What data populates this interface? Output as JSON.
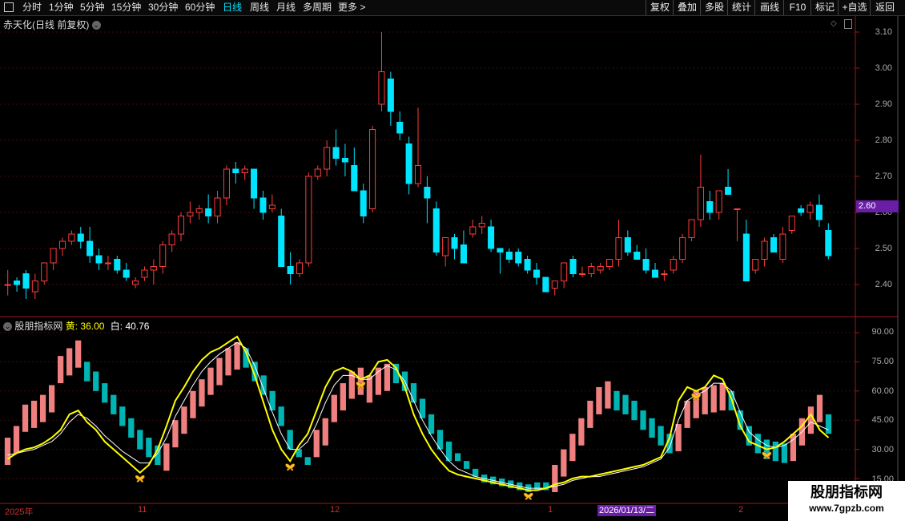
{
  "toolbar": {
    "left_items": [
      "分时",
      "1分钟",
      "5分钟",
      "15分钟",
      "30分钟",
      "60分钟",
      "日线",
      "周线",
      "月线",
      "多周期",
      "更多 >"
    ],
    "active": "日线",
    "right_items": [
      "复权",
      "叠加",
      "多股",
      "统计",
      "画线",
      "F10",
      "标记",
      "+自选",
      "返回"
    ]
  },
  "stock": {
    "title": "赤天化(日线 前复权)"
  },
  "indicator": {
    "name": "股朋指标网",
    "yellow_label": "黄:",
    "yellow_value": "36.00",
    "white_label": "白:",
    "white_value": "40.76"
  },
  "price_axis": [
    "3.10",
    "3.00",
    "2.90",
    "2.80",
    "2.70",
    "2.60",
    "2.50",
    "2.40"
  ],
  "current_price_tag": "2.60",
  "ind_axis": [
    "90.00",
    "75.00",
    "60.00",
    "45.00",
    "30.00",
    "15.00"
  ],
  "x_labels": [
    "2025年",
    "11",
    "12",
    "1",
    "2"
  ],
  "cursor_date": "2026/01/13/二",
  "watermark": {
    "title": "股朋指标网",
    "url": "www.7gpzb.com"
  },
  "colors": {
    "up": "#ff3c3c",
    "down": "#00e5ff",
    "ind_up": "#f08080",
    "ind_down": "#00b4b4",
    "yellow": "#ffff00",
    "white": "#ffffff"
  },
  "chart_data": [
    {
      "type": "candlestick",
      "title": "赤天化(日线 前复权)",
      "ylim": [
        2.36,
        3.12
      ],
      "candles": [
        [
          2.4,
          2.44,
          2.37,
          2.4
        ],
        [
          2.41,
          2.42,
          2.38,
          2.4
        ],
        [
          2.43,
          2.44,
          2.36,
          2.39
        ],
        [
          2.38,
          2.43,
          2.36,
          2.41
        ],
        [
          2.41,
          2.46,
          2.4,
          2.46
        ],
        [
          2.46,
          2.5,
          2.44,
          2.5
        ],
        [
          2.5,
          2.53,
          2.48,
          2.52
        ],
        [
          2.52,
          2.55,
          2.51,
          2.54
        ],
        [
          2.54,
          2.56,
          2.5,
          2.52
        ],
        [
          2.52,
          2.56,
          2.46,
          2.48
        ],
        [
          2.48,
          2.5,
          2.44,
          2.46
        ],
        [
          2.46,
          2.48,
          2.44,
          2.46
        ],
        [
          2.47,
          2.48,
          2.43,
          2.44
        ],
        [
          2.44,
          2.46,
          2.41,
          2.42
        ],
        [
          2.4,
          2.42,
          2.39,
          2.41
        ],
        [
          2.42,
          2.45,
          2.41,
          2.44
        ],
        [
          2.44,
          2.47,
          2.4,
          2.45
        ],
        [
          2.45,
          2.52,
          2.43,
          2.51
        ],
        [
          2.51,
          2.55,
          2.49,
          2.54
        ],
        [
          2.54,
          2.6,
          2.52,
          2.59
        ],
        [
          2.59,
          2.63,
          2.57,
          2.6
        ],
        [
          2.6,
          2.62,
          2.58,
          2.61
        ],
        [
          2.61,
          2.65,
          2.57,
          2.59
        ],
        [
          2.59,
          2.66,
          2.57,
          2.64
        ],
        [
          2.64,
          2.73,
          2.62,
          2.72
        ],
        [
          2.72,
          2.74,
          2.68,
          2.71
        ],
        [
          2.71,
          2.73,
          2.69,
          2.72
        ],
        [
          2.72,
          2.72,
          2.61,
          2.64
        ],
        [
          2.64,
          2.66,
          2.58,
          2.6
        ],
        [
          2.61,
          2.65,
          2.6,
          2.62
        ],
        [
          2.59,
          2.61,
          2.47,
          2.45
        ],
        [
          2.45,
          2.49,
          2.4,
          2.43
        ],
        [
          2.43,
          2.47,
          2.42,
          2.46
        ],
        [
          2.46,
          2.71,
          2.45,
          2.7
        ],
        [
          2.7,
          2.73,
          2.69,
          2.72
        ],
        [
          2.72,
          2.8,
          2.7,
          2.78
        ],
        [
          2.78,
          2.83,
          2.73,
          2.75
        ],
        [
          2.75,
          2.79,
          2.7,
          2.74
        ],
        [
          2.73,
          2.78,
          2.67,
          2.66
        ],
        [
          2.66,
          2.68,
          2.57,
          2.59
        ],
        [
          2.61,
          2.84,
          2.6,
          2.83
        ],
        [
          2.9,
          3.1,
          2.88,
          2.99
        ],
        [
          2.97,
          2.99,
          2.84,
          2.88
        ],
        [
          2.85,
          2.88,
          2.8,
          2.82
        ],
        [
          2.79,
          2.81,
          2.65,
          2.68
        ],
        [
          2.68,
          2.89,
          2.67,
          2.73
        ],
        [
          2.67,
          2.7,
          2.57,
          2.64
        ],
        [
          2.61,
          2.63,
          2.48,
          2.49
        ],
        [
          2.48,
          2.53,
          2.45,
          2.53
        ],
        [
          2.53,
          2.54,
          2.47,
          2.5
        ],
        [
          2.51,
          2.55,
          2.46,
          2.46
        ],
        [
          2.54,
          2.58,
          2.53,
          2.56
        ],
        [
          2.56,
          2.59,
          2.54,
          2.57
        ],
        [
          2.56,
          2.58,
          2.49,
          2.5
        ],
        [
          2.5,
          2.5,
          2.43,
          2.49
        ],
        [
          2.49,
          2.5,
          2.46,
          2.47
        ],
        [
          2.49,
          2.5,
          2.45,
          2.46
        ],
        [
          2.47,
          2.48,
          2.43,
          2.44
        ],
        [
          2.44,
          2.46,
          2.4,
          2.42
        ],
        [
          2.42,
          2.42,
          2.38,
          2.38
        ],
        [
          2.39,
          2.41,
          2.37,
          2.41
        ],
        [
          2.41,
          2.46,
          2.39,
          2.46
        ],
        [
          2.47,
          2.48,
          2.42,
          2.43
        ],
        [
          2.43,
          2.45,
          2.42,
          2.43
        ],
        [
          2.43,
          2.46,
          2.42,
          2.45
        ],
        [
          2.44,
          2.46,
          2.43,
          2.45
        ],
        [
          2.45,
          2.47,
          2.44,
          2.47
        ],
        [
          2.47,
          2.58,
          2.45,
          2.53
        ],
        [
          2.53,
          2.55,
          2.48,
          2.49
        ],
        [
          2.49,
          2.51,
          2.47,
          2.47
        ],
        [
          2.47,
          2.5,
          2.43,
          2.44
        ],
        [
          2.44,
          2.46,
          2.42,
          2.42
        ],
        [
          2.43,
          2.44,
          2.41,
          2.43
        ],
        [
          2.44,
          2.48,
          2.43,
          2.47
        ],
        [
          2.47,
          2.54,
          2.46,
          2.53
        ],
        [
          2.53,
          2.58,
          2.52,
          2.58
        ],
        [
          2.58,
          2.76,
          2.56,
          2.67
        ],
        [
          2.63,
          2.66,
          2.58,
          2.6
        ],
        [
          2.6,
          2.66,
          2.58,
          2.66
        ],
        [
          2.67,
          2.72,
          2.65,
          2.65
        ],
        [
          2.61,
          2.61,
          2.52,
          2.61
        ],
        [
          2.54,
          2.58,
          2.41,
          2.41
        ],
        [
          2.44,
          2.47,
          2.43,
          2.47
        ],
        [
          2.47,
          2.53,
          2.45,
          2.52
        ],
        [
          2.53,
          2.54,
          2.49,
          2.49
        ],
        [
          2.47,
          2.56,
          2.46,
          2.54
        ],
        [
          2.55,
          2.59,
          2.54,
          2.59
        ],
        [
          2.61,
          2.62,
          2.59,
          2.6
        ],
        [
          2.6,
          2.63,
          2.58,
          2.62
        ],
        [
          2.62,
          2.65,
          2.56,
          2.58
        ],
        [
          2.55,
          2.57,
          2.47,
          2.48
        ]
      ]
    },
    {
      "type": "bar_line",
      "title": "股朋指标网",
      "ylim": [
        12,
        95
      ],
      "bars": [
        [
          36,
          null
        ],
        [
          42,
          null
        ],
        [
          53,
          null
        ],
        [
          55,
          null
        ],
        [
          58,
          null
        ],
        [
          63,
          null
        ],
        [
          78,
          null
        ],
        [
          82,
          null
        ],
        [
          86,
          null
        ],
        [
          null,
          75
        ],
        [
          null,
          70
        ],
        [
          null,
          64
        ],
        [
          null,
          58
        ],
        [
          null,
          52
        ],
        [
          null,
          46
        ],
        [
          null,
          40
        ],
        [
          null,
          36
        ],
        [
          null,
          32
        ],
        [
          33,
          null
        ],
        [
          45,
          null
        ],
        [
          52,
          null
        ],
        [
          60,
          null
        ],
        [
          66,
          null
        ],
        [
          72,
          null
        ],
        [
          77,
          null
        ],
        [
          82,
          null
        ],
        [
          85,
          null
        ],
        [
          null,
          82
        ],
        [
          null,
          75
        ],
        [
          null,
          68
        ],
        [
          null,
          60
        ],
        [
          null,
          52
        ],
        [
          null,
          40
        ],
        [
          null,
          30
        ],
        [
          null,
          26
        ],
        [
          40,
          null
        ],
        [
          46,
          null
        ],
        [
          58,
          null
        ],
        [
          64,
          null
        ],
        [
          70,
          null
        ],
        [
          72,
          null
        ],
        [
          68,
          null
        ],
        [
          72,
          null
        ],
        [
          74,
          null
        ],
        [
          null,
          74
        ],
        [
          null,
          70
        ],
        [
          null,
          64
        ],
        [
          null,
          56
        ],
        [
          null,
          48
        ],
        [
          null,
          40
        ],
        [
          null,
          34
        ],
        [
          null,
          28
        ],
        [
          null,
          24
        ],
        [
          null,
          20
        ],
        [
          null,
          17
        ],
        [
          null,
          16
        ],
        [
          null,
          15
        ],
        [
          null,
          14
        ],
        [
          null,
          13
        ],
        [
          null,
          12
        ],
        [
          null,
          13
        ],
        [
          null,
          13
        ],
        [
          22,
          null
        ],
        [
          30,
          null
        ],
        [
          38,
          null
        ],
        [
          46,
          null
        ],
        [
          55,
          null
        ],
        [
          62,
          null
        ],
        [
          65,
          null
        ],
        [
          null,
          60
        ],
        [
          null,
          58
        ],
        [
          null,
          55
        ],
        [
          null,
          50
        ],
        [
          null,
          46
        ],
        [
          null,
          42
        ],
        [
          null,
          38
        ],
        [
          43,
          null
        ],
        [
          55,
          null
        ],
        [
          60,
          null
        ],
        [
          62,
          null
        ],
        [
          63,
          null
        ],
        [
          64,
          null
        ],
        [
          null,
          60
        ],
        [
          null,
          50
        ],
        [
          null,
          42
        ],
        [
          null,
          38
        ],
        [
          null,
          35
        ],
        [
          null,
          34
        ],
        [
          null,
          33
        ],
        [
          38,
          null
        ],
        [
          46,
          null
        ],
        [
          52,
          null
        ],
        [
          58,
          null
        ],
        [
          null,
          48
        ]
      ],
      "series": [
        {
          "name": "黄",
          "values": [
            25,
            28,
            30,
            31,
            33,
            36,
            40,
            48,
            50,
            44,
            40,
            34,
            30,
            26,
            22,
            18,
            22,
            30,
            42,
            55,
            62,
            70,
            76,
            80,
            82,
            85,
            88,
            80,
            68,
            54,
            40,
            30,
            24,
            32,
            38,
            50,
            62,
            70,
            72,
            70,
            66,
            68,
            75,
            76,
            72,
            62,
            48,
            38,
            30,
            24,
            19,
            17,
            16,
            15,
            14,
            13,
            12,
            11,
            10,
            9,
            9,
            10,
            12,
            13,
            15,
            16,
            16,
            17,
            18,
            19,
            20,
            21,
            22,
            24,
            26,
            36,
            55,
            62,
            60,
            62,
            68,
            66,
            56,
            42,
            34,
            32,
            30,
            31,
            34,
            38,
            42,
            48,
            40,
            36
          ]
        },
        {
          "name": "白",
          "values": [
            27,
            28,
            29,
            30,
            32,
            34,
            38,
            44,
            48,
            46,
            42,
            37,
            33,
            29,
            26,
            23,
            23,
            28,
            36,
            47,
            55,
            63,
            70,
            75,
            79,
            82,
            85,
            82,
            73,
            61,
            49,
            38,
            30,
            30,
            34,
            43,
            54,
            63,
            68,
            68,
            66,
            66,
            70,
            73,
            71,
            65,
            55,
            45,
            37,
            30,
            24,
            20,
            18,
            16,
            15,
            14,
            13,
            12,
            11,
            10,
            10,
            10,
            11,
            12,
            14,
            15,
            16,
            16,
            17,
            18,
            19,
            20,
            21,
            23,
            25,
            31,
            45,
            55,
            58,
            60,
            64,
            64,
            60,
            49,
            39,
            35,
            32,
            31,
            32,
            35,
            39,
            44,
            42,
            40
          ]
        }
      ]
    }
  ]
}
